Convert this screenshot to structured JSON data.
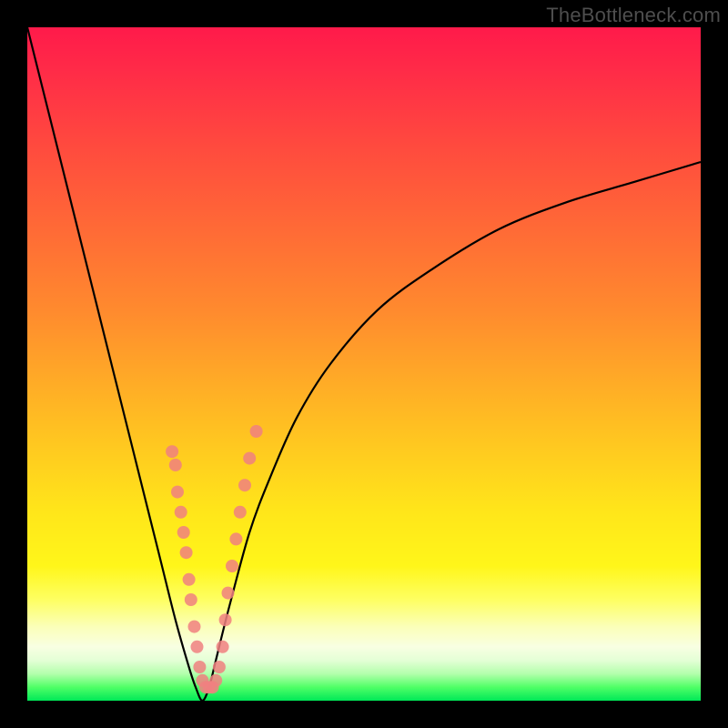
{
  "watermark": "TheBottleneck.com",
  "colors": {
    "frame": "#000000",
    "curve": "#000000",
    "dots": "#f08080",
    "gradient_top": "#ff1a4a",
    "gradient_bottom": "#00e858"
  },
  "chart_data": {
    "type": "line",
    "title": "",
    "xlabel": "",
    "ylabel": "",
    "xlim": [
      0,
      100
    ],
    "ylim": [
      0,
      100
    ],
    "grid": false,
    "series": [
      {
        "name": "bottleneck-curve",
        "x": [
          0,
          5,
          10,
          14,
          18,
          20,
          22,
          24,
          25,
          26,
          27,
          28,
          30,
          33,
          36,
          40,
          45,
          52,
          60,
          70,
          80,
          90,
          100
        ],
        "y": [
          100,
          80,
          60,
          44,
          28,
          20,
          12,
          5,
          2,
          0,
          2,
          6,
          14,
          25,
          33,
          42,
          50,
          58,
          64,
          70,
          74,
          77,
          80
        ]
      }
    ],
    "markers": [
      {
        "x": 21.5,
        "y": 37
      },
      {
        "x": 22.0,
        "y": 35
      },
      {
        "x": 22.3,
        "y": 31
      },
      {
        "x": 22.8,
        "y": 28
      },
      {
        "x": 23.2,
        "y": 25
      },
      {
        "x": 23.6,
        "y": 22
      },
      {
        "x": 24.0,
        "y": 18
      },
      {
        "x": 24.3,
        "y": 15
      },
      {
        "x": 24.8,
        "y": 11
      },
      {
        "x": 25.2,
        "y": 8
      },
      {
        "x": 25.6,
        "y": 5
      },
      {
        "x": 26.0,
        "y": 3
      },
      {
        "x": 26.5,
        "y": 2
      },
      {
        "x": 27.0,
        "y": 2
      },
      {
        "x": 27.5,
        "y": 2
      },
      {
        "x": 28.0,
        "y": 3
      },
      {
        "x": 28.5,
        "y": 5
      },
      {
        "x": 29.0,
        "y": 8
      },
      {
        "x": 29.4,
        "y": 12
      },
      {
        "x": 29.8,
        "y": 16
      },
      {
        "x": 30.4,
        "y": 20
      },
      {
        "x": 31.0,
        "y": 24
      },
      {
        "x": 31.6,
        "y": 28
      },
      {
        "x": 32.3,
        "y": 32
      },
      {
        "x": 33.0,
        "y": 36
      },
      {
        "x": 34.0,
        "y": 40
      }
    ],
    "marker_radius_px": 7
  }
}
